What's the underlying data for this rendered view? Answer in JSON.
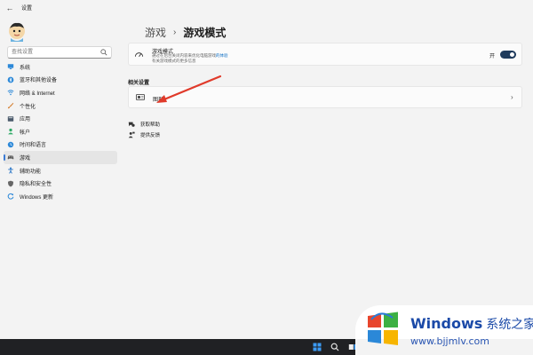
{
  "app": {
    "title": "设置"
  },
  "search": {
    "placeholder": "查找设置"
  },
  "sidebar": {
    "items": [
      {
        "label": "系统",
        "icon": "monitor-icon",
        "color": "#2b88d8"
      },
      {
        "label": "蓝牙和其他设备",
        "icon": "bluetooth-icon",
        "color": "#2b88d8"
      },
      {
        "label": "网络 & Internet",
        "icon": "wifi-icon",
        "color": "#2b88d8"
      },
      {
        "label": "个性化",
        "icon": "brush-icon",
        "color": "#d47b2a"
      },
      {
        "label": "应用",
        "icon": "apps-icon",
        "color": "#4b5a6b"
      },
      {
        "label": "帐户",
        "icon": "person-icon",
        "color": "#2faa66"
      },
      {
        "label": "时间和语言",
        "icon": "clock-globe-icon",
        "color": "#2b88d8"
      },
      {
        "label": "游戏",
        "icon": "gamepad-icon",
        "color": "#555555",
        "active": true
      },
      {
        "label": "辅助功能",
        "icon": "accessibility-icon",
        "color": "#1f6fc4"
      },
      {
        "label": "隐私和安全性",
        "icon": "shield-icon",
        "color": "#666666"
      },
      {
        "label": "Windows 更新",
        "icon": "update-icon",
        "color": "#2b88d8"
      }
    ]
  },
  "header": {
    "parent": "游戏",
    "separator": "›",
    "current": "游戏模式"
  },
  "game_mode": {
    "title": "游戏模式",
    "desc_line1_pre": "通过在后台关闭内容来优化电脑游戏",
    "desc_line1_link": "的体验",
    "desc_line2": "有关游戏模式的更多信息",
    "toggle_label": "开",
    "toggle_on": true
  },
  "related": {
    "section_title": "相关设置",
    "graphics_label": "图形",
    "chevron": "›"
  },
  "links": {
    "help": "获取帮助",
    "feedback": "提供反馈"
  },
  "watermark": {
    "brand": "Windows",
    "brand_cn": "系统之家",
    "url": "www.bjjmlv.com"
  },
  "colors": {
    "accent": "#3a7bd5",
    "toggle": "#1f3b5c",
    "arrow": "#e03a2a",
    "taskbar": "#202124"
  }
}
